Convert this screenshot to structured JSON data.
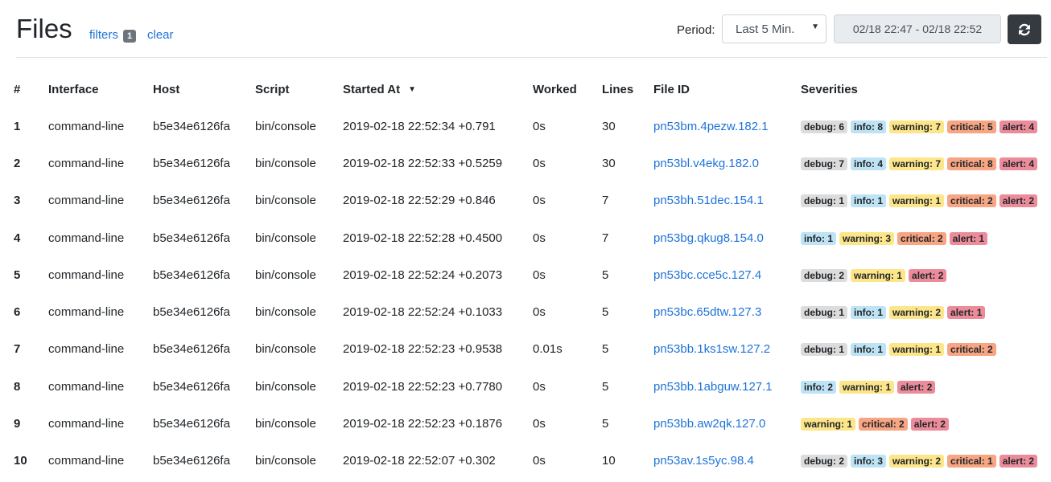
{
  "header": {
    "title": "Files",
    "filters_label": "filters",
    "filters_count": "1",
    "clear_label": "clear",
    "period_label": "Period:",
    "period_value": "Last 5 Min.",
    "range_value": "02/18 22:47 - 02/18 22:52",
    "refresh_icon": "refresh-icon"
  },
  "table": {
    "columns": [
      "#",
      "Interface",
      "Host",
      "Script",
      "Started At",
      "Worked",
      "Lines",
      "File ID",
      "Severities"
    ],
    "sorted_column": "Started At",
    "rows": [
      {
        "n": "1",
        "iface": "command-line",
        "host": "b5e34e6126fa",
        "script": "bin/console",
        "started": "2019-02-18 22:52:34 +0.791",
        "worked": "0s",
        "lines": "30",
        "file_id": "pn53bm.4pezw.182.1",
        "severities": [
          {
            "level": "debug",
            "label": "debug: 6"
          },
          {
            "level": "info",
            "label": "info: 8"
          },
          {
            "level": "warning",
            "label": "warning: 7"
          },
          {
            "level": "critical",
            "label": "critical: 5"
          },
          {
            "level": "alert",
            "label": "alert: 4"
          }
        ]
      },
      {
        "n": "2",
        "iface": "command-line",
        "host": "b5e34e6126fa",
        "script": "bin/console",
        "started": "2019-02-18 22:52:33 +0.5259",
        "worked": "0s",
        "lines": "30",
        "file_id": "pn53bl.v4ekg.182.0",
        "severities": [
          {
            "level": "debug",
            "label": "debug: 7"
          },
          {
            "level": "info",
            "label": "info: 4"
          },
          {
            "level": "warning",
            "label": "warning: 7"
          },
          {
            "level": "critical",
            "label": "critical: 8"
          },
          {
            "level": "alert",
            "label": "alert: 4"
          }
        ]
      },
      {
        "n": "3",
        "iface": "command-line",
        "host": "b5e34e6126fa",
        "script": "bin/console",
        "started": "2019-02-18 22:52:29 +0.846",
        "worked": "0s",
        "lines": "7",
        "file_id": "pn53bh.51dec.154.1",
        "severities": [
          {
            "level": "debug",
            "label": "debug: 1"
          },
          {
            "level": "info",
            "label": "info: 1"
          },
          {
            "level": "warning",
            "label": "warning: 1"
          },
          {
            "level": "critical",
            "label": "critical: 2"
          },
          {
            "level": "alert",
            "label": "alert: 2"
          }
        ]
      },
      {
        "n": "4",
        "iface": "command-line",
        "host": "b5e34e6126fa",
        "script": "bin/console",
        "started": "2019-02-18 22:52:28 +0.4500",
        "worked": "0s",
        "lines": "7",
        "file_id": "pn53bg.qkug8.154.0",
        "severities": [
          {
            "level": "info",
            "label": "info: 1"
          },
          {
            "level": "warning",
            "label": "warning: 3"
          },
          {
            "level": "critical",
            "label": "critical: 2"
          },
          {
            "level": "alert",
            "label": "alert: 1"
          }
        ]
      },
      {
        "n": "5",
        "iface": "command-line",
        "host": "b5e34e6126fa",
        "script": "bin/console",
        "started": "2019-02-18 22:52:24 +0.2073",
        "worked": "0s",
        "lines": "5",
        "file_id": "pn53bc.cce5c.127.4",
        "severities": [
          {
            "level": "debug",
            "label": "debug: 2"
          },
          {
            "level": "warning",
            "label": "warning: 1"
          },
          {
            "level": "alert",
            "label": "alert: 2"
          }
        ]
      },
      {
        "n": "6",
        "iface": "command-line",
        "host": "b5e34e6126fa",
        "script": "bin/console",
        "started": "2019-02-18 22:52:24 +0.1033",
        "worked": "0s",
        "lines": "5",
        "file_id": "pn53bc.65dtw.127.3",
        "severities": [
          {
            "level": "debug",
            "label": "debug: 1"
          },
          {
            "level": "info",
            "label": "info: 1"
          },
          {
            "level": "warning",
            "label": "warning: 2"
          },
          {
            "level": "alert",
            "label": "alert: 1"
          }
        ]
      },
      {
        "n": "7",
        "iface": "command-line",
        "host": "b5e34e6126fa",
        "script": "bin/console",
        "started": "2019-02-18 22:52:23 +0.9538",
        "worked": "0.01s",
        "lines": "5",
        "file_id": "pn53bb.1ks1sw.127.2",
        "severities": [
          {
            "level": "debug",
            "label": "debug: 1"
          },
          {
            "level": "info",
            "label": "info: 1"
          },
          {
            "level": "warning",
            "label": "warning: 1"
          },
          {
            "level": "critical",
            "label": "critical: 2"
          }
        ]
      },
      {
        "n": "8",
        "iface": "command-line",
        "host": "b5e34e6126fa",
        "script": "bin/console",
        "started": "2019-02-18 22:52:23 +0.7780",
        "worked": "0s",
        "lines": "5",
        "file_id": "pn53bb.1abguw.127.1",
        "severities": [
          {
            "level": "info",
            "label": "info: 2"
          },
          {
            "level": "warning",
            "label": "warning: 1"
          },
          {
            "level": "alert",
            "label": "alert: 2"
          }
        ]
      },
      {
        "n": "9",
        "iface": "command-line",
        "host": "b5e34e6126fa",
        "script": "bin/console",
        "started": "2019-02-18 22:52:23 +0.1876",
        "worked": "0s",
        "lines": "5",
        "file_id": "pn53bb.aw2qk.127.0",
        "severities": [
          {
            "level": "warning",
            "label": "warning: 1"
          },
          {
            "level": "critical",
            "label": "critical: 2"
          },
          {
            "level": "alert",
            "label": "alert: 2"
          }
        ]
      },
      {
        "n": "10",
        "iface": "command-line",
        "host": "b5e34e6126fa",
        "script": "bin/console",
        "started": "2019-02-18 22:52:07 +0.302",
        "worked": "0s",
        "lines": "10",
        "file_id": "pn53av.1s5yc.98.4",
        "severities": [
          {
            "level": "debug",
            "label": "debug: 2"
          },
          {
            "level": "info",
            "label": "info: 3"
          },
          {
            "level": "warning",
            "label": "warning: 2"
          },
          {
            "level": "critical",
            "label": "critical: 1"
          },
          {
            "level": "alert",
            "label": "alert: 2"
          }
        ]
      }
    ]
  }
}
